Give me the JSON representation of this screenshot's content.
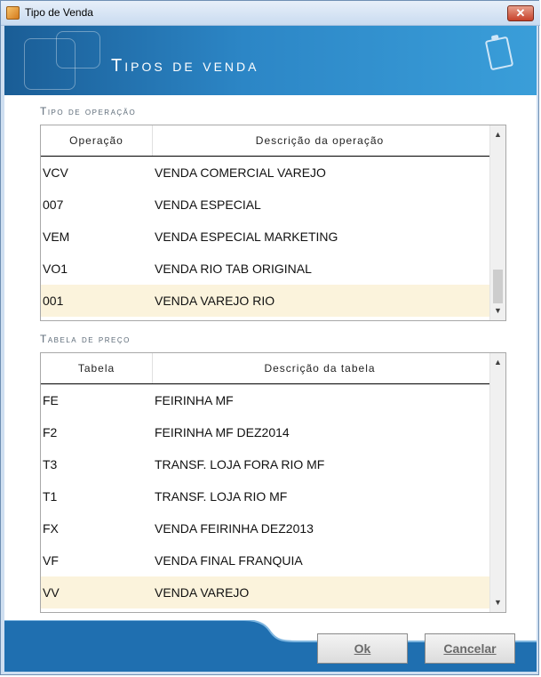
{
  "window": {
    "title": "Tipo de Venda",
    "close_label": "✕"
  },
  "banner": {
    "title": "Tipos de venda"
  },
  "operation_section": {
    "label": "Tipo de operação",
    "columns": [
      "Operação",
      "Descrição da operação"
    ],
    "rows": [
      {
        "code": "VCV",
        "desc": "VENDA COMERCIAL VAREJO"
      },
      {
        "code": "007",
        "desc": "VENDA ESPECIAL"
      },
      {
        "code": "VEM",
        "desc": "VENDA ESPECIAL MARKETING"
      },
      {
        "code": "VO1",
        "desc": "VENDA RIO TAB ORIGINAL"
      },
      {
        "code": "001",
        "desc": "VENDA VAREJO RIO"
      }
    ],
    "selected_index": 4
  },
  "price_section": {
    "label": "Tabela de preço",
    "columns": [
      "Tabela",
      "Descrição da tabela"
    ],
    "rows": [
      {
        "code": "FE",
        "desc": "FEIRINHA MF"
      },
      {
        "code": "F2",
        "desc": "FEIRINHA MF DEZ2014"
      },
      {
        "code": "T3",
        "desc": "TRANSF. LOJA FORA RIO MF"
      },
      {
        "code": "T1",
        "desc": "TRANSF. LOJA RIO MF"
      },
      {
        "code": "FX",
        "desc": "VENDA FEIRINHA DEZ2013"
      },
      {
        "code": "VF",
        "desc": "VENDA FINAL FRANQUIA"
      },
      {
        "code": "VV",
        "desc": "VENDA VAREJO"
      }
    ],
    "selected_index": 6
  },
  "buttons": {
    "ok": "Ok",
    "cancel": "Cancelar"
  },
  "colors": {
    "banner_start": "#1a5d96",
    "banner_end": "#3a9ed9",
    "selected_row": "#fbf3dc"
  }
}
